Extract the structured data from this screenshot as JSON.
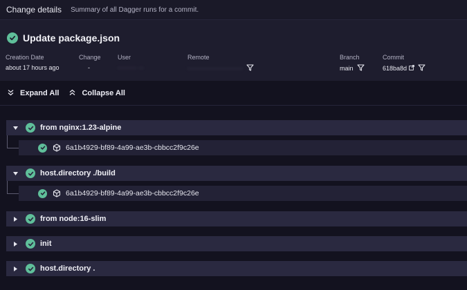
{
  "header": {
    "title": "Change details",
    "subtitle": "Summary of all Dagger runs for a commit."
  },
  "run": {
    "title": "Update package.json",
    "status": "success"
  },
  "meta": {
    "creation_date_label": "Creation Date",
    "creation_date_value": "about 17 hours ago",
    "change_label": "Change",
    "change_value": "-",
    "user_label": "User",
    "user_value": "········ ··",
    "remote_label": "Remote",
    "remote_value": "·······················",
    "branch_label": "Branch",
    "branch_value": "main",
    "commit_label": "Commit",
    "commit_value": "618ba8d"
  },
  "actions": {
    "expand_all": "Expand All",
    "collapse_all": "Collapse All"
  },
  "groups": [
    {
      "label": "from nginx:1.23-alpine",
      "expanded": true,
      "children": [
        {
          "label": "6a1b4929-bf89-4a99-ae3b-cbbcc2f9c26e"
        }
      ]
    },
    {
      "label": "host.directory ./build",
      "expanded": true,
      "children": [
        {
          "label": "6a1b4929-bf89-4a99-ae3b-cbbcc2f9c26e"
        }
      ]
    },
    {
      "label": "from node:16-slim",
      "expanded": false,
      "children": []
    },
    {
      "label": "init",
      "expanded": false,
      "children": []
    },
    {
      "label": "host.directory .",
      "expanded": false,
      "children": []
    }
  ],
  "colors": {
    "success": "#5fbf9a",
    "background": "#13121f",
    "row": "#2a2940",
    "child_row": "#232236"
  },
  "icons": [
    "check-circle-icon",
    "filter-icon",
    "external-link-icon",
    "expand-all-icon",
    "collapse-all-icon",
    "caret-down-icon",
    "caret-right-icon",
    "cube-icon"
  ]
}
